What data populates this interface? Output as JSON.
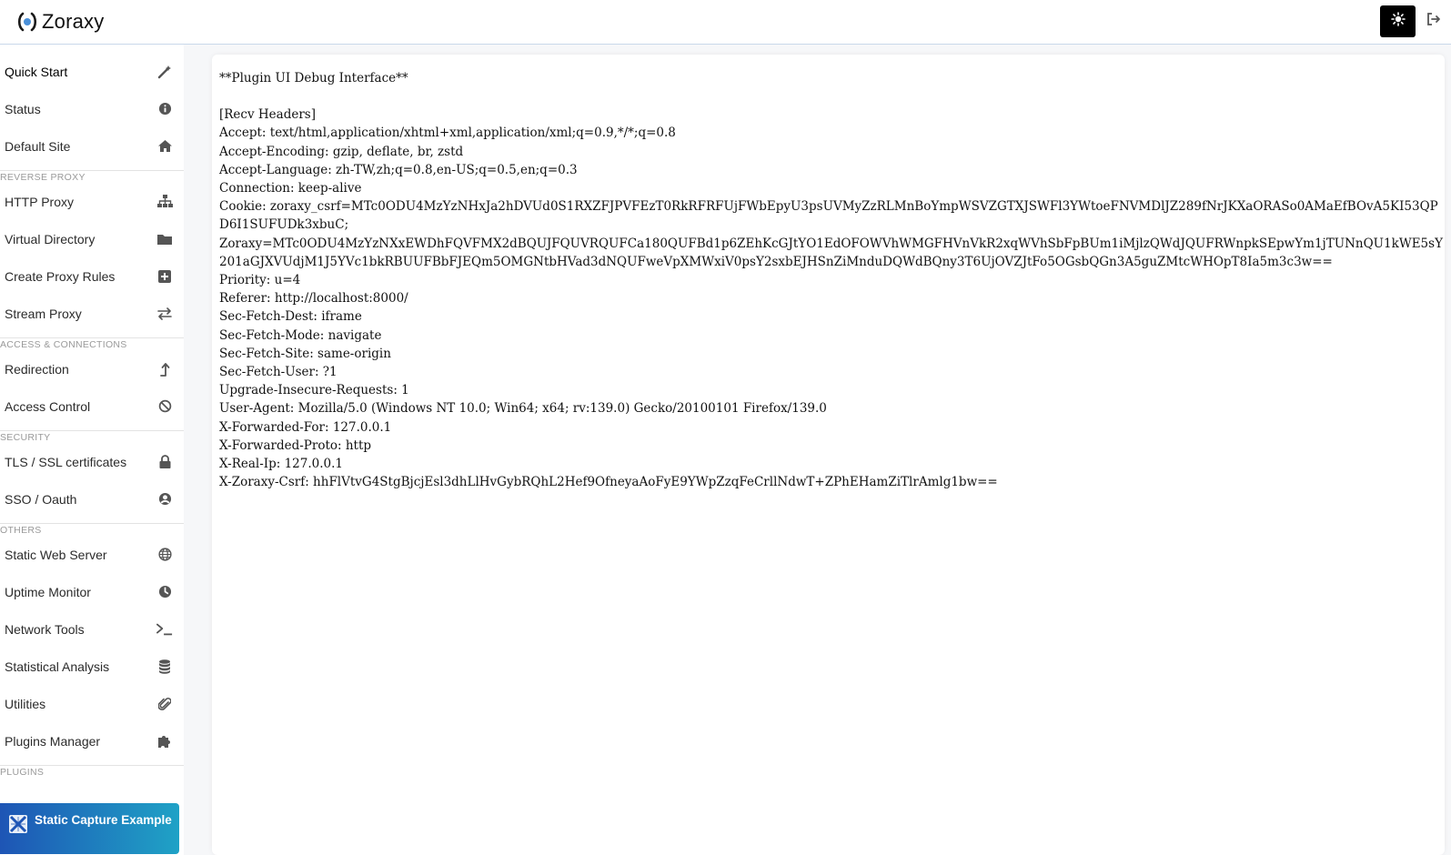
{
  "app": {
    "title": "Zoraxy"
  },
  "icons": {
    "brand": "zoraxy-logo-icon",
    "theme": "sun-icon",
    "logout": "logout-icon"
  },
  "sidebar": {
    "items": [
      {
        "label": "Quick Start",
        "icon": "magic-wand-icon"
      },
      {
        "label": "Status",
        "icon": "info-circle-icon"
      },
      {
        "label": "Default Site",
        "icon": "home-icon"
      }
    ],
    "sections": [
      {
        "label": "REVERSE PROXY",
        "items": [
          {
            "label": "HTTP Proxy",
            "icon": "sitemap-icon"
          },
          {
            "label": "Virtual Directory",
            "icon": "folder-icon"
          },
          {
            "label": "Create Proxy Rules",
            "icon": "plus-square-icon"
          },
          {
            "label": "Stream Proxy",
            "icon": "exchange-icon"
          }
        ]
      },
      {
        "label": "ACCESS & CONNECTIONS",
        "items": [
          {
            "label": "Redirection",
            "icon": "level-up-icon"
          },
          {
            "label": "Access Control",
            "icon": "ban-icon"
          }
        ]
      },
      {
        "label": "SECURITY",
        "items": [
          {
            "label": "TLS / SSL certificates",
            "icon": "lock-icon"
          },
          {
            "label": "SSO / Oauth",
            "icon": "user-circle-icon"
          }
        ]
      },
      {
        "label": "OTHERS",
        "items": [
          {
            "label": "Static Web Server",
            "icon": "globe-icon"
          },
          {
            "label": "Uptime Monitor",
            "icon": "clock-icon"
          },
          {
            "label": "Network Tools",
            "icon": "terminal-icon"
          },
          {
            "label": "Statistical Analysis",
            "icon": "database-icon"
          },
          {
            "label": "Utilities",
            "icon": "paperclip-icon"
          },
          {
            "label": "Plugins Manager",
            "icon": "puzzle-icon"
          }
        ]
      }
    ],
    "plugins": {
      "label": "PLUGINS",
      "active_plugin": {
        "label": "Static Capture Example",
        "icon": "plugin-logo-icon"
      }
    }
  },
  "debug": {
    "lines": [
      "**Plugin UI Debug Interface**",
      "",
      "[Recv Headers]",
      "Accept: text/html,application/xhtml+xml,application/xml;q=0.9,*/*;q=0.8",
      "Accept-Encoding: gzip, deflate, br, zstd",
      "Accept-Language: zh-TW,zh;q=0.8,en-US;q=0.5,en;q=0.3",
      "Connection: keep-alive",
      "Cookie: zoraxy_csrf=MTc0ODU4MzYzNHxJa2hDVUd0S1RXZFJPVFEzT0RkRFRFUjFWbEpyU3psUVMyZzRLMnBoYmpWSVZGTXJSWFl3YWtoeFNVMDlJZ289fNrJKXaORASo0AMaEfBOvA5KI53QPD6I1SUFUDk3xbuC;",
      "Zoraxy=MTc0ODU4MzYzNXxEWDhFQVFMX2dBQUJFQUVRQUFCa180QUFBd1p6ZEhKcGJtYO1EdOFOWVhWMGFHVnVkR2xqWVhSbFpBUm1iMjlzQWdJQUFRWnpkSEpwYm1jTUNnQU1kWE5sY201aGJXVUdjM1J5YVc1bkRBUUFBbFJEQm5OMGNtbHVad3dNQUFweVpXMWxiV0psY2sxbEJHSnZiMnduDQWdBQny3T6UjOVZJtFo5OGsbQGn3A5guZMtcWHOpT8Ia5m3c3w==",
      "Priority: u=4",
      "Referer: http://localhost:8000/",
      "Sec-Fetch-Dest: iframe",
      "Sec-Fetch-Mode: navigate",
      "Sec-Fetch-Site: same-origin",
      "Sec-Fetch-User: ?1",
      "Upgrade-Insecure-Requests: 1",
      "User-Agent: Mozilla/5.0 (Windows NT 10.0; Win64; x64; rv:139.0) Gecko/20100101 Firefox/139.0",
      "X-Forwarded-For: 127.0.0.1",
      "X-Forwarded-Proto: http",
      "X-Real-Ip: 127.0.0.1",
      "X-Zoraxy-Csrf: hhFlVtvG4StgBjcjEsl3dhLlHvGybRQhL2Hef9OfneyaAoFyE9YWpZzqFeCrllNdwT+ZPhEHamZiTlrAmlg1bw=="
    ]
  },
  "colors": {
    "accent_start": "#1e55b5",
    "accent_end": "#1fa2c6",
    "theme_button": "#000000"
  }
}
